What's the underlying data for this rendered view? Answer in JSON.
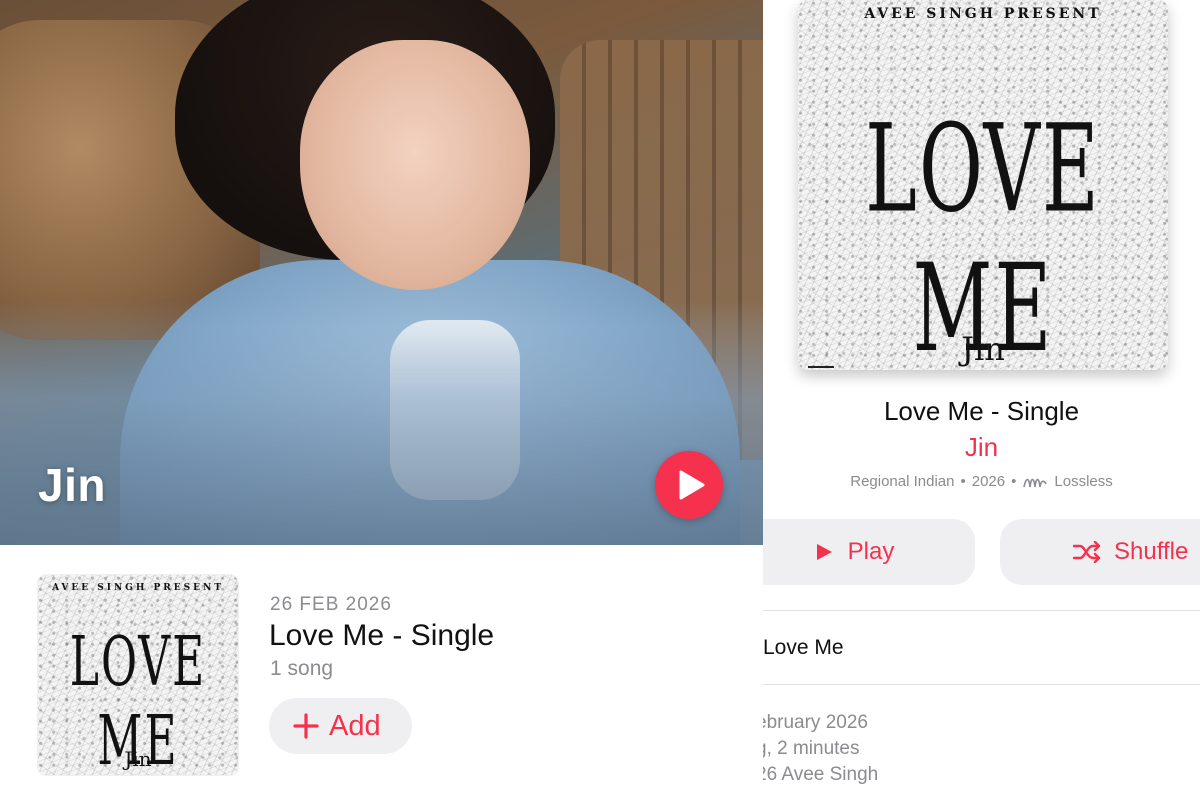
{
  "artist": {
    "name": "Jin",
    "play_icon": "play-icon"
  },
  "latest_release": {
    "date": "26 FEB 2026",
    "title": "Love Me - Single",
    "song_count": "1 song",
    "add_label": "Add",
    "add_icon": "plus-icon"
  },
  "artwork": {
    "presenter": "Avee Singh Present",
    "title": "LOVE ME",
    "artist": "Jin"
  },
  "album": {
    "title": "Love Me - Single",
    "artist": "Jin",
    "genre": "Regional Indian",
    "year": "2026",
    "quality": "Lossless",
    "separator": "•",
    "play_label": "Play",
    "shuffle_label": "Shuffle"
  },
  "tracks": [
    {
      "title": "Love Me"
    }
  ],
  "footer_info": {
    "release_date": "ebruary 2026",
    "length": "g, 2 minutes",
    "copyright": "26 Avee Singh"
  },
  "colors": {
    "accent": "#f5314d",
    "secondary_text": "#8b8b90",
    "button_bg": "#efeff1"
  }
}
